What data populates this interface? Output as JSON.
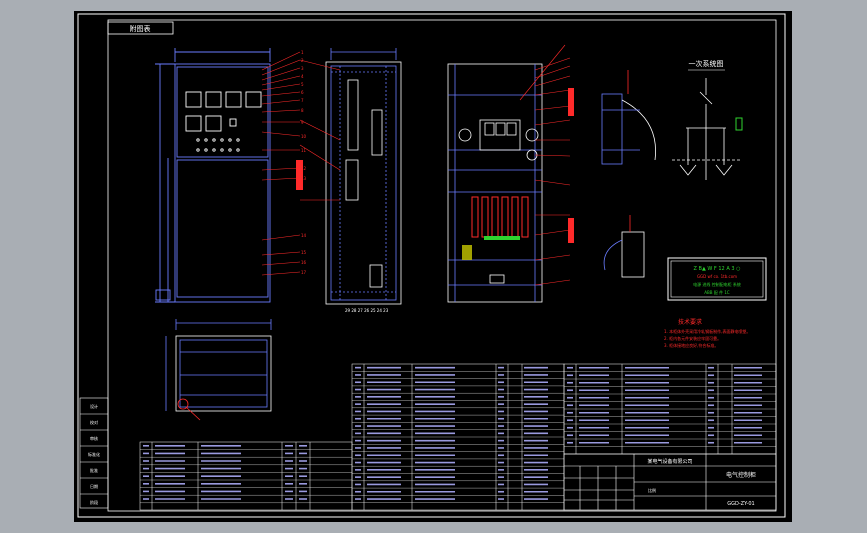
{
  "drawing": {
    "stamp_text": "附图表",
    "colors": {
      "page": "#a9aeb4",
      "sheet": "#000000",
      "frame": "#ffffff",
      "line": "#6a7cff",
      "red": "#ff2a2a",
      "green": "#2fd52f",
      "label": "#d8d8ff"
    }
  },
  "single_line": {
    "title": "一次系统图"
  },
  "nameplate": {
    "line1": "Z B▲  W F 12 A 3 ○",
    "line2": "GGD  wf  co. 1tb.com",
    "line3": "电源 进线 控制配电柜 系统",
    "line4": "ABB 配 件 1C"
  },
  "notes": {
    "title": "技术要求",
    "items": [
      "1. 本柜体外壳采用冷轧钢板制作,表面静电喷塑。",
      "2. 柜内各元件安装应牢固可靠。",
      "3. 柜体接地应良好,符合标准。"
    ]
  },
  "title_block": {
    "drawing_name": "电气控制柜",
    "company": "某电气设备有限公司",
    "scale_label": "比例",
    "drawing_no": "GGD-ZY-01"
  },
  "side_block": {
    "rows": [
      "设计",
      "校对",
      "审核",
      "标准化",
      "批准",
      "日期",
      "阶段"
    ]
  }
}
